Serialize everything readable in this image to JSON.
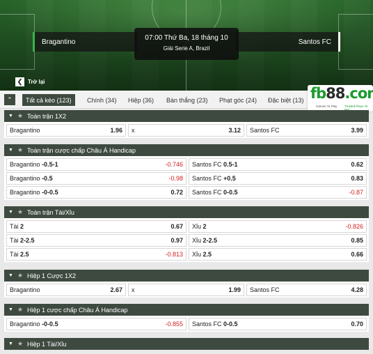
{
  "match": {
    "home_team": "Bragantino",
    "away_team": "Santos FC",
    "datetime": "07:00 Thứ Ba, 18 tháng 10",
    "league": "Giải Serie A, Brazil"
  },
  "back_label": "Trở lại",
  "back_icon": "chevron-left-icon",
  "logo": {
    "brand_letters": "fb",
    "brand_number": "88",
    "brand_suffix": ".com",
    "tagline_left": "Games To Play",
    "tagline_right": "Trusted Place To Bet"
  },
  "tabs": [
    {
      "label": "Tất cả kèo (123)",
      "active": true
    },
    {
      "label": "Chính (34)"
    },
    {
      "label": "Hiệp (36)"
    },
    {
      "label": "Bàn thắng (23)"
    },
    {
      "label": "Phạt góc (24)"
    },
    {
      "label": "Đặc biệt (13)"
    }
  ],
  "sections": [
    {
      "title": "Toàn trận 1X2",
      "rows": [
        [
          {
            "label": "Bragantino",
            "odds": "1.96"
          },
          {
            "label": "x",
            "odds": "3.12"
          },
          {
            "label": "Santos FC",
            "odds": "3.99"
          }
        ]
      ]
    },
    {
      "title": "Toàn trận cược chấp Châu Á Handicap",
      "rows": [
        [
          {
            "label": "Bragantino",
            "line": "-0.5-1",
            "odds": "-0.746"
          },
          {
            "label": "Santos FC",
            "line": "0.5-1",
            "odds": "0.62"
          }
        ],
        [
          {
            "label": "Bragantino",
            "line": "-0.5",
            "odds": "-0.98"
          },
          {
            "label": "Santos FC",
            "line": "+0.5",
            "odds": "0.83"
          }
        ],
        [
          {
            "label": "Bragantino",
            "line": "-0-0.5",
            "odds": "0.72"
          },
          {
            "label": "Santos FC",
            "line": "0-0.5",
            "odds": "-0.87"
          }
        ]
      ]
    },
    {
      "title": "Toàn trận Tài/Xỉu",
      "rows": [
        [
          {
            "label": "Tài",
            "line": "2",
            "odds": "0.67"
          },
          {
            "label": "Xỉu",
            "line": "2",
            "odds": "-0.826"
          }
        ],
        [
          {
            "label": "Tài",
            "line": "2-2.5",
            "odds": "0.97"
          },
          {
            "label": "Xỉu",
            "line": "2-2.5",
            "odds": "0.85"
          }
        ],
        [
          {
            "label": "Tài",
            "line": "2.5",
            "odds": "-0.813"
          },
          {
            "label": "Xỉu",
            "line": "2.5",
            "odds": "0.66"
          }
        ]
      ]
    },
    {
      "title": "Hiệp 1 Cược 1X2",
      "rows": [
        [
          {
            "label": "Bragantino",
            "odds": "2.67"
          },
          {
            "label": "x",
            "odds": "1.99"
          },
          {
            "label": "Santos FC",
            "odds": "4.28"
          }
        ]
      ]
    },
    {
      "title": "Hiệp 1 cược chấp Châu Á Handicap",
      "rows": [
        [
          {
            "label": "Bragantino",
            "line": "-0-0.5",
            "odds": "-0.855"
          },
          {
            "label": "Santos FC",
            "line": "0-0.5",
            "odds": "0.70"
          }
        ]
      ]
    },
    {
      "title": "Hiệp 1 Tài/Xỉu",
      "rows": []
    }
  ],
  "colors": {
    "header_dark": "#3e4a40",
    "negative_odds": "#d42020",
    "brand_green": "#1a9b2d"
  }
}
